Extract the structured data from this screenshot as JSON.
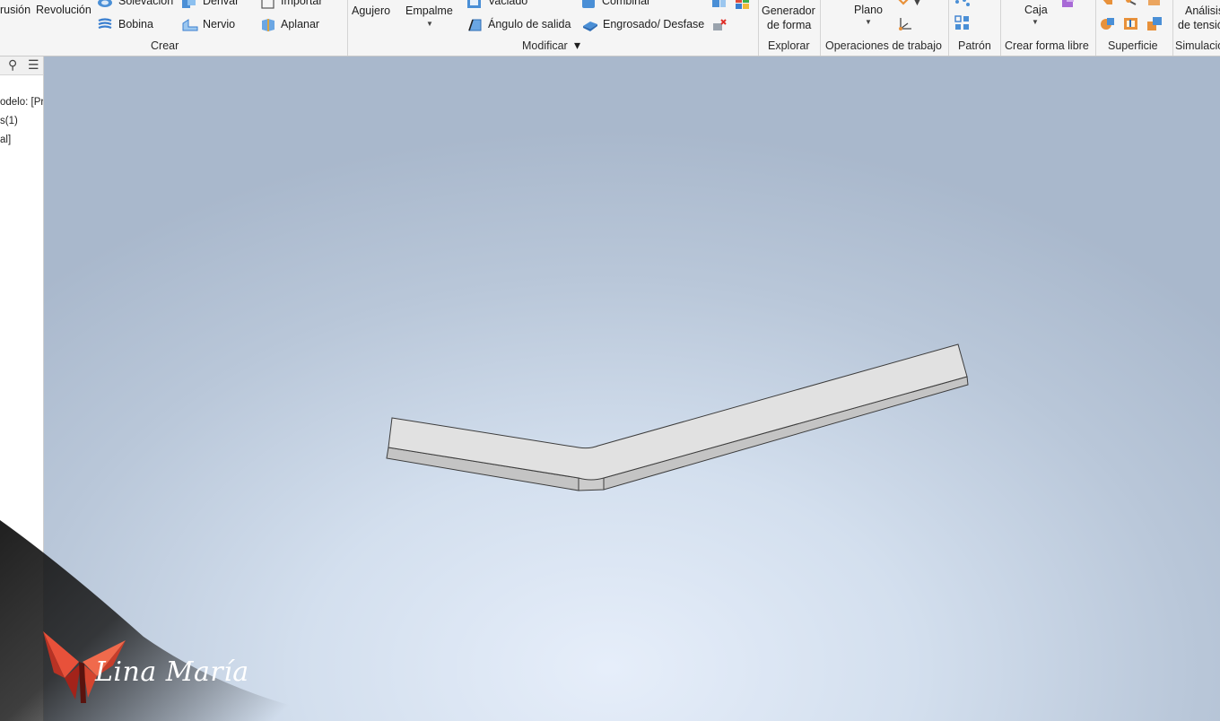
{
  "ribbon": {
    "crear": {
      "extrusion": "rusión",
      "revolucion": "Revolución",
      "solevacion": "Solevación",
      "derivar": "Derivar",
      "importar": "Importar",
      "bobina": "Bobina",
      "nervio": "Nervio",
      "aplanar": "Aplanar",
      "label": "Crear"
    },
    "modificar": {
      "agujero": "Agujero",
      "empalme": "Empalme",
      "vaciado": "Vaciado",
      "combinar": "Combinar",
      "angulo": "Ángulo de salida",
      "engrosado": "Engrosado/ Desfase",
      "label": "Modificar",
      "dropdown_glyph": "▾"
    },
    "explorar": {
      "generador_line1": "Generador",
      "generador_line2": "de forma",
      "label": "Explorar"
    },
    "operaciones": {
      "plano": "Plano",
      "label": "Operaciones de trabajo"
    },
    "patron": {
      "label": "Patrón"
    },
    "forma_libre": {
      "caja": "Caja",
      "label": "Crear forma libre"
    },
    "superficie": {
      "label": "Superficie"
    },
    "simulacion": {
      "analisis_line1": "Análisis",
      "analisis_line2": "de tensió",
      "label": "Simulació"
    }
  },
  "browser": {
    "search_glyph": "⚲",
    "menu_glyph": "☰",
    "items": [
      "odelo: [Pri",
      "s(1)",
      "al]"
    ]
  },
  "watermark": {
    "text": "Lina María",
    "colors": {
      "primary": "#e8513a",
      "dark": "#a3231a",
      "light": "#f58a6e"
    }
  },
  "colors": {
    "ribbon_bg": "#f5f5f5",
    "viewport_center": "#e6eefa",
    "viewport_edge": "#a9b8cc",
    "part_top": "#e1e1e1",
    "part_side": "#c4c4c4",
    "part_edge": "#3c3c3c"
  }
}
